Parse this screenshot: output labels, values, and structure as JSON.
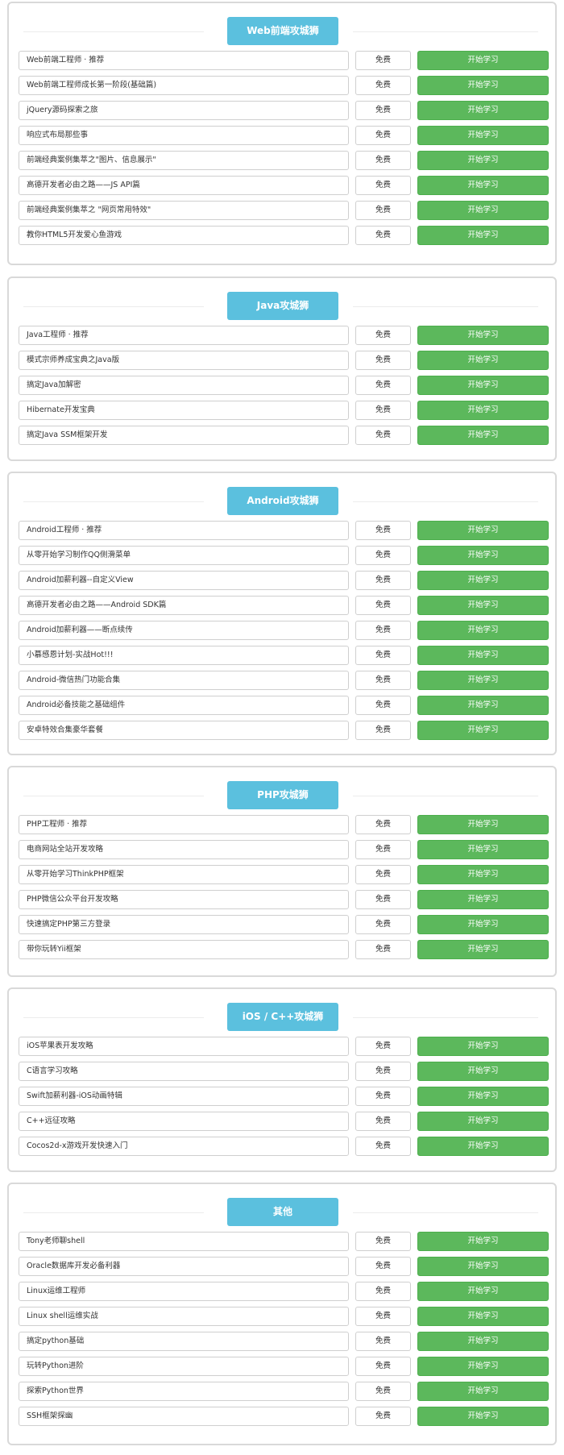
{
  "colors": {
    "header_bg": "#5bc0de",
    "start_button_bg": "#5cb85c",
    "border": "#d9d9d9"
  },
  "sections": [
    {
      "title": "Web前端攻城狮",
      "courses": [
        {
          "name": "Web前端工程师 · 推荐",
          "price": "免费",
          "action": "开始学习"
        },
        {
          "name": "Web前端工程师成长第一阶段(基础篇)",
          "price": "免费",
          "action": "开始学习"
        },
        {
          "name": "jQuery源码探索之旅",
          "price": "免费",
          "action": "开始学习"
        },
        {
          "name": "响应式布局那些事",
          "price": "免费",
          "action": "开始学习"
        },
        {
          "name": "前端经典案例集萃之\"图片、信息展示\"",
          "price": "免费",
          "action": "开始学习"
        },
        {
          "name": "高德开发者必由之路——JS API篇",
          "price": "免费",
          "action": "开始学习"
        },
        {
          "name": "前端经典案例集萃之 \"网页常用特效\"",
          "price": "免费",
          "action": "开始学习"
        },
        {
          "name": "教你HTML5开发爱心鱼游戏",
          "price": "免费",
          "action": "开始学习"
        }
      ]
    },
    {
      "title": "Java攻城狮",
      "courses": [
        {
          "name": "Java工程师 · 推荐",
          "price": "免费",
          "action": "开始学习"
        },
        {
          "name": "模式宗师养成宝典之Java版",
          "price": "免费",
          "action": "开始学习"
        },
        {
          "name": "搞定Java加解密",
          "price": "免费",
          "action": "开始学习"
        },
        {
          "name": "Hibernate开发宝典",
          "price": "免费",
          "action": "开始学习"
        },
        {
          "name": "搞定Java SSM框架开发",
          "price": "免费",
          "action": "开始学习"
        }
      ]
    },
    {
      "title": "Android攻城狮",
      "courses": [
        {
          "name": "Android工程师 · 推荐",
          "price": "免费",
          "action": "开始学习"
        },
        {
          "name": "从零开始学习制作QQ侧滑菜单",
          "price": "免费",
          "action": "开始学习"
        },
        {
          "name": "Android加薪利器--自定义View",
          "price": "免费",
          "action": "开始学习"
        },
        {
          "name": "高德开发者必由之路——Android SDK篇",
          "price": "免费",
          "action": "开始学习"
        },
        {
          "name": "Android加薪利器——断点续传",
          "price": "免费",
          "action": "开始学习"
        },
        {
          "name": "小慕感恩计划-实战Hot!!!",
          "price": "免费",
          "action": "开始学习"
        },
        {
          "name": "Android-微信热门功能合集",
          "price": "免费",
          "action": "开始学习"
        },
        {
          "name": "Android必备技能之基础组件",
          "price": "免费",
          "action": "开始学习"
        },
        {
          "name": "安卓特效合集豪华套餐",
          "price": "免费",
          "action": "开始学习"
        }
      ]
    },
    {
      "title": "PHP攻城狮",
      "courses": [
        {
          "name": "PHP工程师 · 推荐",
          "price": "免费",
          "action": "开始学习"
        },
        {
          "name": "电商网站全站开发攻略",
          "price": "免费",
          "action": "开始学习"
        },
        {
          "name": "从零开始学习ThinkPHP框架",
          "price": "免费",
          "action": "开始学习"
        },
        {
          "name": "PHP微信公众平台开发攻略",
          "price": "免费",
          "action": "开始学习"
        },
        {
          "name": "快速搞定PHP第三方登录",
          "price": "免费",
          "action": "开始学习"
        },
        {
          "name": "带你玩转Yii框架",
          "price": "免费",
          "action": "开始学习"
        }
      ]
    },
    {
      "title": "iOS / C++攻城狮",
      "courses": [
        {
          "name": "iOS苹果表开发攻略",
          "price": "免费",
          "action": "开始学习"
        },
        {
          "name": "C语言学习攻略",
          "price": "免费",
          "action": "开始学习"
        },
        {
          "name": "Swift加薪利器-iOS动画特辑",
          "price": "免费",
          "action": "开始学习"
        },
        {
          "name": "C++远征攻略",
          "price": "免费",
          "action": "开始学习"
        },
        {
          "name": "Cocos2d-x游戏开发快速入门",
          "price": "免费",
          "action": "开始学习"
        }
      ]
    },
    {
      "title": "其他",
      "courses": [
        {
          "name": "Tony老师聊shell",
          "price": "免费",
          "action": "开始学习"
        },
        {
          "name": "Oracle数据库开发必备利器",
          "price": "免费",
          "action": "开始学习"
        },
        {
          "name": "Linux运维工程师",
          "price": "免费",
          "action": "开始学习"
        },
        {
          "name": "Linux shell运维实战",
          "price": "免费",
          "action": "开始学习"
        },
        {
          "name": "搞定python基础",
          "price": "免费",
          "action": "开始学习"
        },
        {
          "name": "玩转Python进阶",
          "price": "免费",
          "action": "开始学习"
        },
        {
          "name": "探索Python世界",
          "price": "免费",
          "action": "开始学习"
        },
        {
          "name": "SSH框架探幽",
          "price": "免费",
          "action": "开始学习"
        }
      ]
    }
  ]
}
